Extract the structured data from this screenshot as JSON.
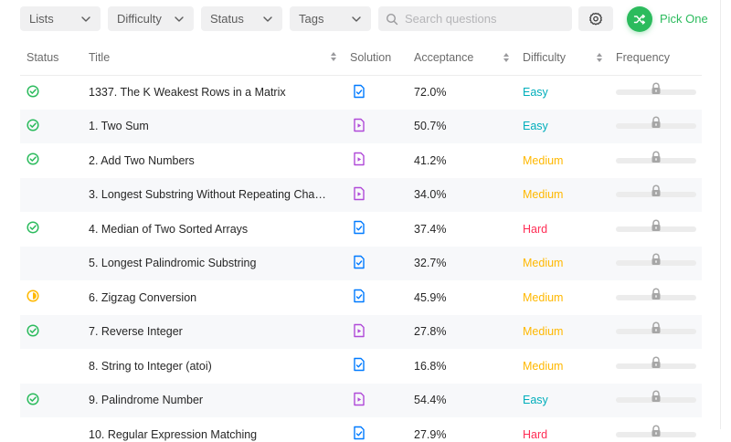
{
  "filters": {
    "lists": "Lists",
    "difficulty": "Difficulty",
    "status": "Status",
    "tags": "Tags"
  },
  "search": {
    "placeholder": "Search questions",
    "value": ""
  },
  "pick_one": "Pick One",
  "colors": {
    "accent_green": "#2cbb5d",
    "easy": "#00aebb",
    "medium": "#ffb800",
    "hard": "#ff2d55",
    "attempted": "#ffb800",
    "solution_blue": "#007aff",
    "solution_purple": "#b04ad8"
  },
  "table": {
    "columns": [
      "Status",
      "Title",
      "Solution",
      "Acceptance",
      "Difficulty",
      "Frequency"
    ],
    "rows": [
      {
        "status": "solved",
        "status_icon": "check-circle-icon",
        "title": "1337. The K Weakest Rows in a Matrix",
        "solution": "article",
        "solution_icon": "doc-check-icon",
        "acceptance": "72.0%",
        "difficulty": "Easy",
        "frequency": "locked"
      },
      {
        "status": "solved",
        "status_icon": "check-circle-icon",
        "title": "1. Two Sum",
        "solution": "video",
        "solution_icon": "doc-play-icon",
        "acceptance": "50.7%",
        "difficulty": "Easy",
        "frequency": "locked"
      },
      {
        "status": "solved",
        "status_icon": "check-circle-icon",
        "title": "2. Add Two Numbers",
        "solution": "video",
        "solution_icon": "doc-play-icon",
        "acceptance": "41.2%",
        "difficulty": "Medium",
        "frequency": "locked"
      },
      {
        "status": "none",
        "status_icon": "",
        "title": "3. Longest Substring Without Repeating Charac...",
        "solution": "video",
        "solution_icon": "doc-play-icon",
        "acceptance": "34.0%",
        "difficulty": "Medium",
        "frequency": "locked"
      },
      {
        "status": "solved",
        "status_icon": "check-circle-icon",
        "title": "4. Median of Two Sorted Arrays",
        "solution": "article",
        "solution_icon": "doc-check-icon",
        "acceptance": "37.4%",
        "difficulty": "Hard",
        "frequency": "locked"
      },
      {
        "status": "none",
        "status_icon": "",
        "title": "5. Longest Palindromic Substring",
        "solution": "article",
        "solution_icon": "doc-check-icon",
        "acceptance": "32.7%",
        "difficulty": "Medium",
        "frequency": "locked"
      },
      {
        "status": "attempted",
        "status_icon": "attempted-icon",
        "title": "6. Zigzag Conversion",
        "solution": "article",
        "solution_icon": "doc-check-icon",
        "acceptance": "45.9%",
        "difficulty": "Medium",
        "frequency": "locked"
      },
      {
        "status": "solved",
        "status_icon": "check-circle-icon",
        "title": "7. Reverse Integer",
        "solution": "video",
        "solution_icon": "doc-play-icon",
        "acceptance": "27.8%",
        "difficulty": "Medium",
        "frequency": "locked"
      },
      {
        "status": "none",
        "status_icon": "",
        "title": "8. String to Integer (atoi)",
        "solution": "article",
        "solution_icon": "doc-check-icon",
        "acceptance": "16.8%",
        "difficulty": "Medium",
        "frequency": "locked"
      },
      {
        "status": "solved",
        "status_icon": "check-circle-icon",
        "title": "9. Palindrome Number",
        "solution": "video",
        "solution_icon": "doc-play-icon",
        "acceptance": "54.4%",
        "difficulty": "Easy",
        "frequency": "locked"
      },
      {
        "status": "none",
        "status_icon": "",
        "title": "10. Regular Expression Matching",
        "solution": "article",
        "solution_icon": "doc-check-icon",
        "acceptance": "27.9%",
        "difficulty": "Hard",
        "frequency": "locked"
      }
    ]
  }
}
